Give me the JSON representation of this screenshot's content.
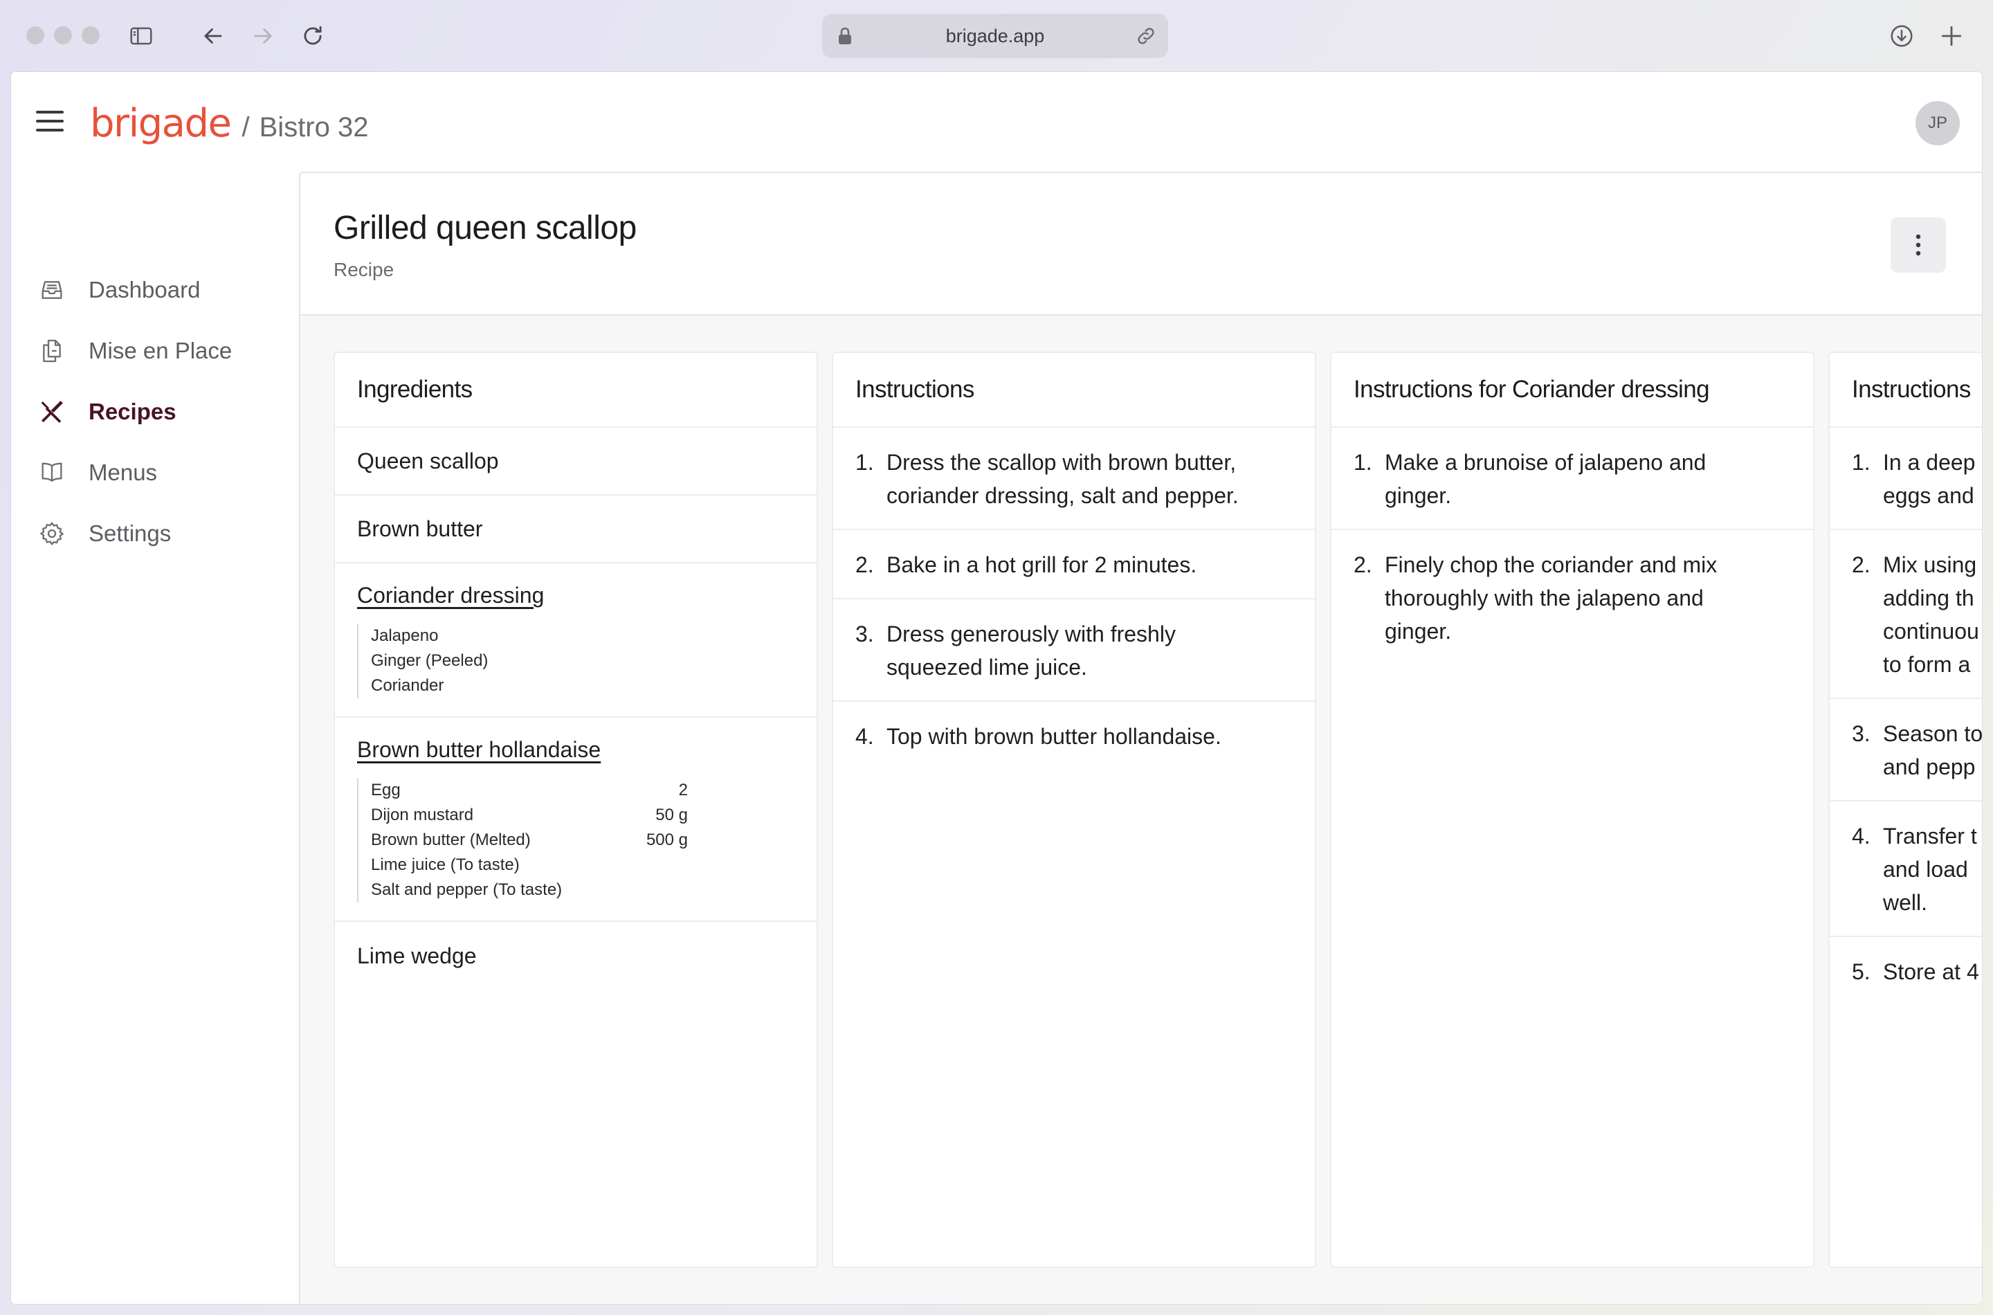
{
  "browser": {
    "url": "brigade.app"
  },
  "app": {
    "brand": "brigade",
    "separator": "/",
    "org": "Bistro 32",
    "avatar_initials": "JP",
    "brand_color": "#e8513a"
  },
  "sidebar": {
    "items": [
      {
        "label": "Dashboard",
        "icon": "inbox-icon",
        "active": false
      },
      {
        "label": "Mise en Place",
        "icon": "documents-icon",
        "active": false
      },
      {
        "label": "Recipes",
        "icon": "utensils-icon",
        "active": true
      },
      {
        "label": "Menus",
        "icon": "book-icon",
        "active": false
      },
      {
        "label": "Settings",
        "icon": "gear-icon",
        "active": false
      }
    ]
  },
  "page": {
    "title": "Grilled queen scallop",
    "subtitle": "Recipe"
  },
  "ingredients": {
    "title": "Ingredients",
    "items": [
      {
        "name": "Queen scallop"
      },
      {
        "name": "Brown butter"
      },
      {
        "name": "Coriander dressing",
        "sub": [
          {
            "name": "Jalapeno",
            "qty": ""
          },
          {
            "name": "Ginger (Peeled)",
            "qty": ""
          },
          {
            "name": "Coriander",
            "qty": ""
          }
        ]
      },
      {
        "name": "Brown butter hollandaise",
        "sub": [
          {
            "name": "Egg",
            "qty": "2"
          },
          {
            "name": "Dijon mustard",
            "qty": "50 g"
          },
          {
            "name": "Brown butter (Melted)",
            "qty": "500 g"
          },
          {
            "name": "Lime juice (To taste)",
            "qty": ""
          },
          {
            "name": "Salt and pepper (To taste)",
            "qty": ""
          }
        ]
      },
      {
        "name": "Lime wedge"
      }
    ]
  },
  "instructions": [
    {
      "title": "Instructions",
      "steps": [
        {
          "num": "1.",
          "lines": [
            "Dress the scallop with brown butter,",
            "coriander dressing, salt and pepper."
          ]
        },
        {
          "num": "2.",
          "lines": [
            "Bake in a hot grill for 2 minutes."
          ]
        },
        {
          "num": "3.",
          "lines": [
            "Dress generously with freshly",
            "squeezed lime juice."
          ]
        },
        {
          "num": "4.",
          "lines": [
            "Top with brown butter hollandaise."
          ]
        }
      ]
    },
    {
      "title": "Instructions for Coriander dressing",
      "steps": [
        {
          "num": "1.",
          "lines": [
            "Make a brunoise of jalapeno and",
            "ginger."
          ]
        },
        {
          "num": "2.",
          "lines": [
            "Finely chop the coriander and mix",
            "thoroughly with the jalapeno and",
            "ginger."
          ]
        }
      ]
    },
    {
      "title": "Instructions",
      "steps": [
        {
          "num": "1.",
          "lines": [
            "In a deep",
            "eggs and"
          ]
        },
        {
          "num": "2.",
          "lines": [
            "Mix using",
            "adding th",
            "continuou",
            "to form a"
          ]
        },
        {
          "num": "3.",
          "lines": [
            "Season to",
            "and pepp"
          ]
        },
        {
          "num": "4.",
          "lines": [
            "Transfer t",
            "and load",
            "well."
          ]
        },
        {
          "num": "5.",
          "lines": [
            "Store at 4"
          ]
        }
      ]
    }
  ]
}
